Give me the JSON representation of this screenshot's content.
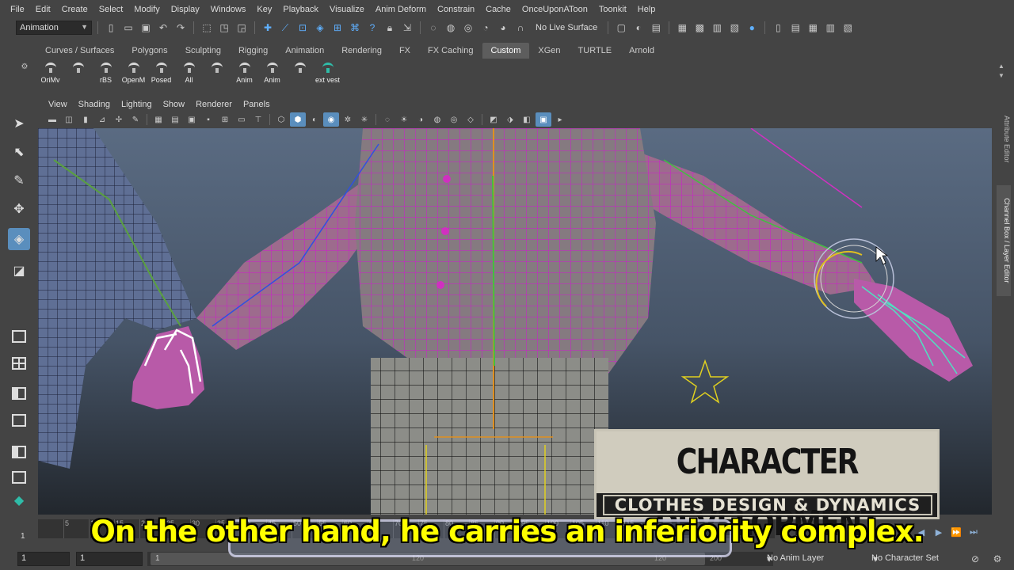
{
  "menubar": {
    "items": [
      "File",
      "Edit",
      "Create",
      "Select",
      "Modify",
      "Display",
      "Windows",
      "Key",
      "Playback",
      "Visualize",
      "Anim Deform",
      "Constrain",
      "Cache",
      "OnceUponAToon",
      "Toonkit",
      "Help"
    ]
  },
  "statusline": {
    "mode": "Animation",
    "live_surface": "No Live Surface",
    "icons": [
      "new-scene-icon",
      "open-scene-icon",
      "save-scene-icon",
      "undo-icon",
      "redo-icon",
      "select-hierarchy-icon",
      "select-object-icon",
      "select-component-icon",
      "snap-grid-icon",
      "snap-curve-icon",
      "snap-point-icon",
      "snap-view-icon",
      "snap-surface-icon",
      "render-frame-icon",
      "ipr-render-icon",
      "render-settings-icon"
    ]
  },
  "shelf": {
    "tabs": [
      "Curves / Surfaces",
      "Polygons",
      "Sculpting",
      "Rigging",
      "Animation",
      "Rendering",
      "FX",
      "FX Caching",
      "Custom",
      "XGen",
      "TURTLE",
      "Arnold"
    ],
    "active_tab": "Custom",
    "buttons": [
      {
        "label": "OriMv",
        "icon": "script-icon"
      },
      {
        "label": "",
        "icon": "script-icon"
      },
      {
        "label": "rBS",
        "icon": "script-icon"
      },
      {
        "label": "OpenM",
        "icon": "script-icon"
      },
      {
        "label": "Posed",
        "icon": "script-icon"
      },
      {
        "label": "All",
        "icon": "script-icon"
      },
      {
        "label": "",
        "icon": "script-icon"
      },
      {
        "label": "Anim",
        "icon": "script-icon"
      },
      {
        "label": "Anim",
        "icon": "script-icon"
      },
      {
        "label": "",
        "icon": "script-icon"
      },
      {
        "label": "ext vest",
        "icon": "maya-script-icon"
      }
    ]
  },
  "panel": {
    "menu": [
      "View",
      "Shading",
      "Lighting",
      "Show",
      "Renderer",
      "Panels"
    ]
  },
  "right_tabs": {
    "attribute_editor": "Attribute Editor",
    "channel_box": "Channel Box / Layer Editor"
  },
  "timeslider": {
    "ticks": [
      "5",
      "10",
      "15",
      "20",
      "25",
      "30",
      "35",
      "40",
      "45",
      "50",
      "55",
      "60",
      "65",
      "70",
      "75",
      "80",
      "85",
      "90",
      "95",
      "100",
      "105",
      "110",
      "115",
      "120"
    ],
    "current_frame": "1"
  },
  "rangebar": {
    "start": "1",
    "start_inner": "1",
    "handle_label": "1",
    "inner_mid": "120",
    "inner_end": "120",
    "inner_end2": "200",
    "anim_layer": "No Anim Layer",
    "character_set": "No Character Set"
  },
  "title_card": {
    "line1": "CHARACTER DEVELOPMENT",
    "line2": "CLOTHES DESIGN & DYNAMICS"
  },
  "subtitle": "On the other hand, he carries an inferiority complex.",
  "colors": {
    "accent": "#5a8ebd",
    "wire_selected": "#e000e0",
    "subtitle": "#ffff00"
  }
}
